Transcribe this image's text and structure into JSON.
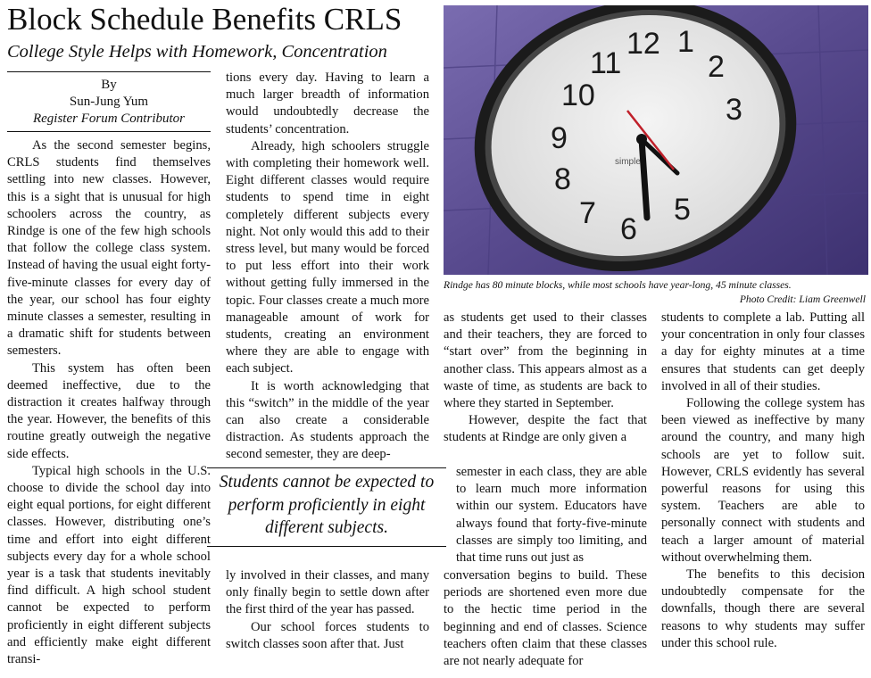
{
  "article": {
    "headline": "Block Schedule Benefits CRLS",
    "subheadline": "College Style Helps with Homework, Concentration",
    "byline": {
      "by": "By",
      "author": "Sun-Jung Yum",
      "role": "Register Forum Contributor"
    },
    "col1": {
      "p1": "As the second semester begins, CRLS students find themselves settling into new classes. However, this is a sight that is unusual for high schoolers across the country, as Rindge is one of the few high schools that follow the college class system. Instead of having the usual eight forty-five-minute classes for every day of the year, our school has four eighty minute classes a semester, resulting in a dramatic shift for students between semesters.",
      "p2": "This system has often been deemed ineffective, due to the distraction it creates halfway through the year. However, the benefits of this routine greatly outweigh the negative side effects.",
      "p3": "Typical high schools in the U.S. choose to divide the school day into eight equal portions, for eight different classes. However, distributing one’s time and effort into eight different subjects every day for a whole school year is a task that students inevitably find difficult. A high school student cannot be expected to perform proficiently in eight different subjects and efficiently make eight different transi-"
    },
    "col2_top": {
      "p1": "tions every day. Having to learn a much larger breadth of information would undoubtedly decrease the students’ concentration.",
      "p2": "Already, high schoolers struggle with completing their homework well. Eight different classes would require students to spend time in eight completely different subjects every night. Not only would this add to their stress level, but many would be forced to put less effort into their work without getting fully immersed in the topic. Four classes create a much more manageable amount of work for students, creating an environment where they are able to engage with each subject.",
      "p3": "It is worth acknowledging that this “switch” in the middle of the year can also create a considerable distraction. As students approach the second semester, they are deep-"
    },
    "col2_bottom": {
      "p1": "ly involved in their classes, and many only finally begin to settle down after the first third of the year has passed.",
      "p2": "Our school forces students to switch classes soon after that. Just"
    },
    "pull_quote": "Students cannot be expected to perform proficiently in eight different subjects.",
    "col3": {
      "p1": "as students get used to their classes and their teachers, they are forced to “start over” from the beginning in another class. This appears almost as a waste of time, as students are back to where they started in September.",
      "p2a": "However, despite the fact that students at Rindge are only given a",
      "p2b": "semester in each class, they are able to learn much more information within our system. Educators have always found that forty-five-minute classes are simply too limiting, and that time runs out just as",
      "p2c": "conversation begins to build. These periods are shortened even more due to the hectic time period in the beginning and end of classes. Science teachers often claim that these classes are not nearly adequate for"
    },
    "col4": {
      "p1": "students to complete a lab. Putting all your concentration in only four classes a day for eighty minutes at a time ensures that students can get deeply involved in all of their studies.",
      "p2": "Following the college system has been viewed as ineffective by many around the country, and many high schools are yet to follow suit. However, CRLS evidently has several powerful reasons for using this system. Teachers are able to personally connect with students and teach a larger amount of material without overwhelming them.",
      "p3": "The benefits to this decision undoubtedly compensate for the downfalls, though there are several reasons to why students may suffer under this school rule."
    }
  },
  "photo": {
    "caption": "Rindge has 80 minute blocks, while most schools have year-long, 45 minute classes.",
    "credit": "Photo Credit: Liam Greenwell",
    "clock_numerals": [
      "12",
      "1",
      "2",
      "3",
      "5",
      "6",
      "7",
      "8",
      "9",
      "10",
      "11"
    ],
    "clock_brand": "simplex",
    "colors": {
      "wall": "#5b4e92",
      "clock_face": "#eeeeee",
      "second_hand": "#c0202a"
    }
  }
}
